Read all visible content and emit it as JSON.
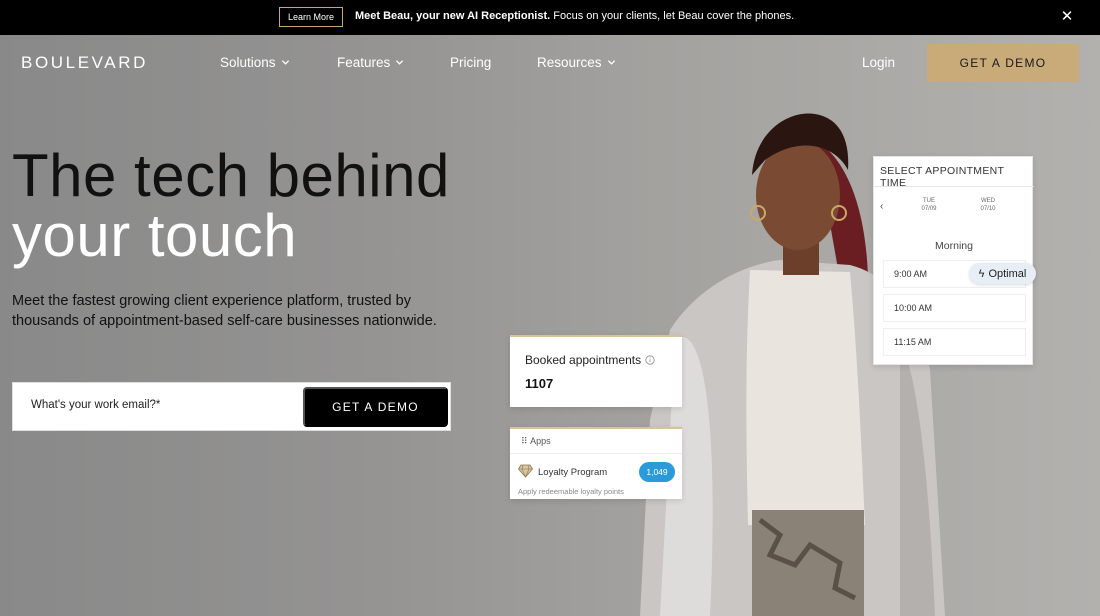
{
  "announcement": {
    "learn_more": "Learn More",
    "bold_text": "Meet Beau, your new AI Receptionist.",
    "text": " Focus on your clients, let Beau cover the phones.",
    "close_icon": "close-icon"
  },
  "nav": {
    "logo": "BOULEVARD",
    "items": [
      {
        "label": "Solutions",
        "has_dropdown": true
      },
      {
        "label": "Features",
        "has_dropdown": true
      },
      {
        "label": "Pricing",
        "has_dropdown": false
      },
      {
        "label": "Resources",
        "has_dropdown": true
      }
    ],
    "login": "Login",
    "demo": "GET A DEMO"
  },
  "hero": {
    "headline_line1": "The tech behind",
    "headline_line2": "your touch",
    "subtext": "Meet the fastest growing client experience platform, trusted by thousands of appointment-based self-care businesses nationwide.",
    "email_placeholder": "What's your work email?*",
    "demo_button": "GET A DEMO"
  },
  "appointment_card": {
    "title": "SELECT APPOINTMENT TIME",
    "back_icon": "chevron-left-icon",
    "days": [
      {
        "name": "TUE",
        "date": "07/09"
      },
      {
        "name": "WED",
        "date": "07/10"
      }
    ],
    "period": "Morning",
    "slots": [
      "9:00 AM",
      "10:00 AM",
      "11:15 AM"
    ],
    "optimal": "Optimal"
  },
  "booked_card": {
    "title": "Booked appointments",
    "value": "1107"
  },
  "apps_card": {
    "label": "Apps",
    "program": "Loyalty Program",
    "count": "1,049",
    "subtext": "Apply redeemable loyalty points"
  },
  "colors": {
    "announcement_bg": "#000000",
    "accent_gold": "#c8ab78",
    "pill_blue": "#2a9bd8"
  }
}
